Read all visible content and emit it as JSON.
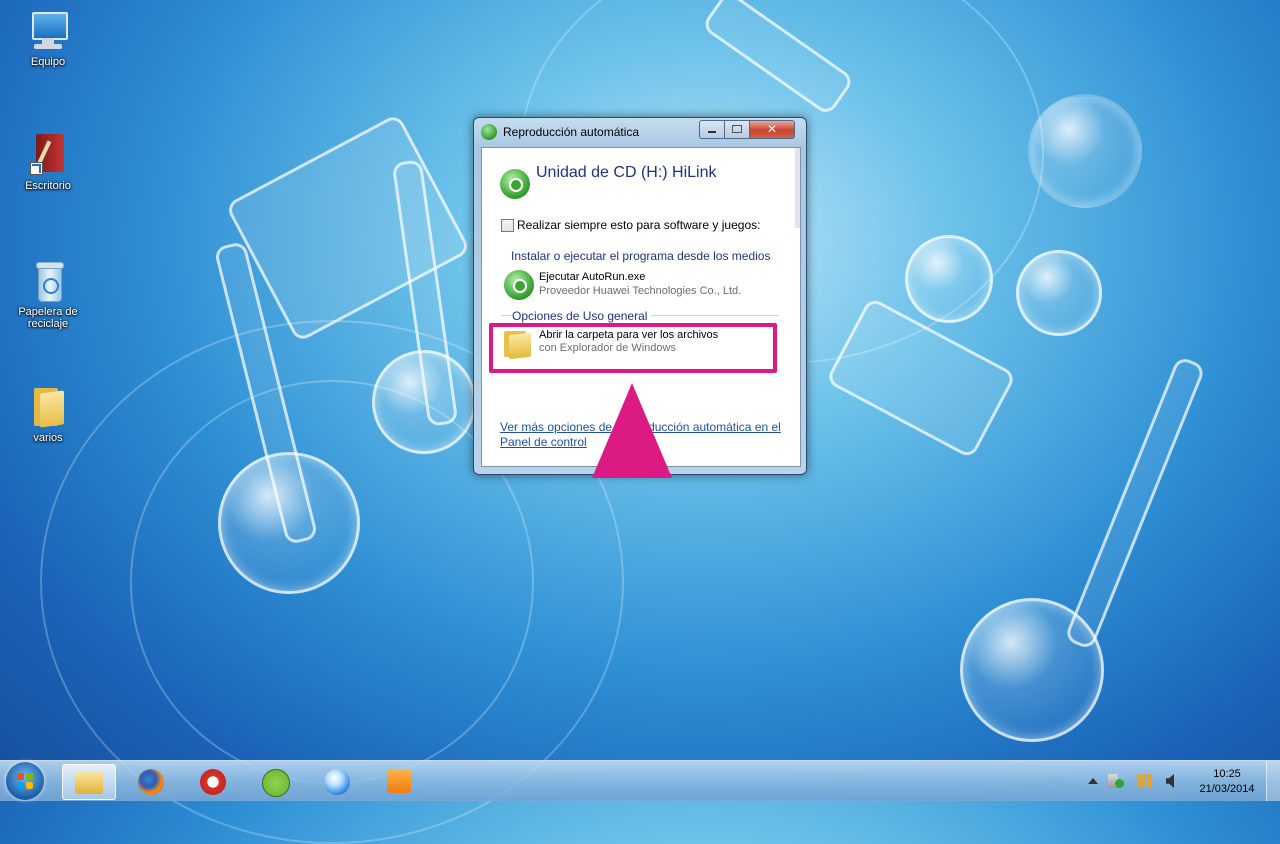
{
  "desktop": {
    "icons": [
      {
        "label": "Equipo",
        "icon": "computer-icon"
      },
      {
        "label": "Escritorio",
        "icon": "book-shortcut-icon"
      },
      {
        "label": "Papelera de reciclaje",
        "icon": "recycle-bin-icon"
      },
      {
        "label": "varios",
        "icon": "folder-icon"
      }
    ]
  },
  "dialog": {
    "title": "Reproducción automática",
    "heading": "Unidad de CD (H:) HiLink",
    "checkbox_label": "Realizar siempre esto para software y juegos:",
    "checkbox_checked": false,
    "section_install": "Instalar o ejecutar el programa desde los medios",
    "run_option": {
      "title": "Ejecutar AutoRun.exe",
      "subtitle": "Proveedor Huawei Technologies Co., Ltd."
    },
    "section_general": "Opciones de Uso general",
    "open_folder_option": {
      "title": "Abrir la carpeta para ver los archivos",
      "subtitle": "con Explorador de Windows"
    },
    "control_panel_link": "Ver más opciones de Reproducción automática en el Panel de control",
    "close_symbol": "✕"
  },
  "annotation": {
    "highlight_color": "#dc1a84"
  },
  "taskbar": {
    "pinned": [
      "explorer-icon",
      "firefox-icon",
      "ccleaner-icon",
      "spotify-icon",
      "itunes-icon",
      "media-player-icon"
    ],
    "clock": {
      "time": "10:25",
      "date": "21/03/2014"
    }
  }
}
